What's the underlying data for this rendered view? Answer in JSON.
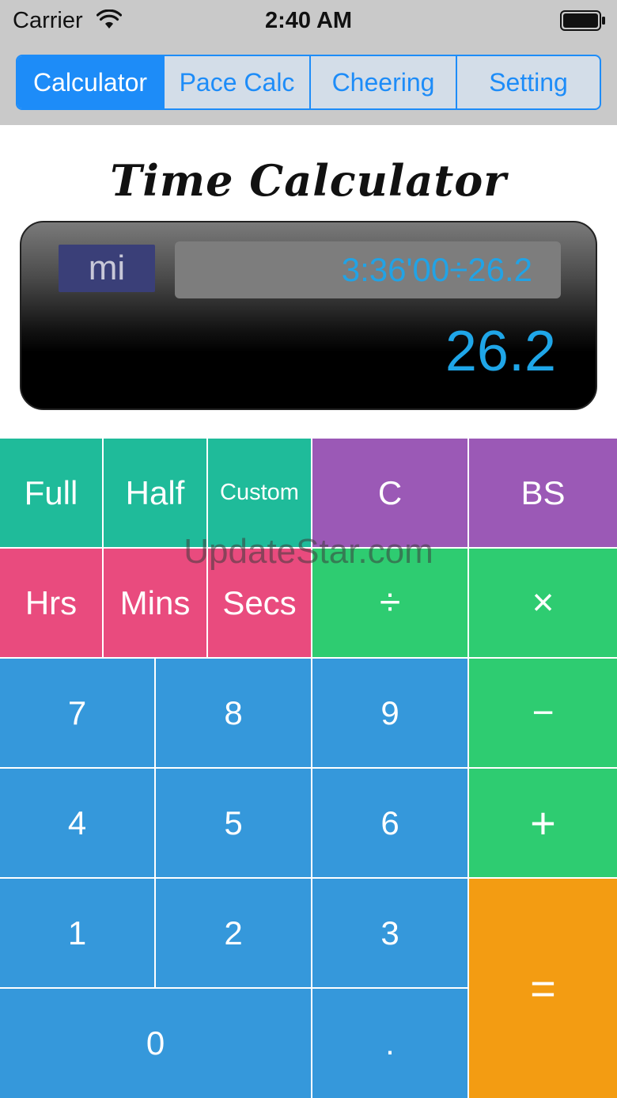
{
  "status_bar": {
    "carrier": "Carrier",
    "time": "2:40 AM",
    "wifi_icon": "wifi-icon",
    "battery_icon": "battery-icon"
  },
  "tabs": [
    {
      "label": "Calculator",
      "active": true
    },
    {
      "label": "Pace Calc",
      "active": false
    },
    {
      "label": "Cheering",
      "active": false
    },
    {
      "label": "Setting",
      "active": false
    }
  ],
  "title": "Time Calculator",
  "display": {
    "unit": "mi",
    "expression": "3:36'00÷26.2",
    "result": "26.2"
  },
  "keypad": {
    "full": "Full",
    "half": "Half",
    "custom": "Custom",
    "clear": "C",
    "backspace": "BS",
    "hrs": "Hrs",
    "mins": "Mins",
    "secs": "Secs",
    "divide": "÷",
    "multiply": "×",
    "seven": "7",
    "eight": "8",
    "nine": "9",
    "minus": "−",
    "four": "4",
    "five": "5",
    "six": "6",
    "plus": "+",
    "one": "1",
    "two": "2",
    "three": "3",
    "equals": "=",
    "zero": "0",
    "decimal": "."
  },
  "watermark": "UpdateStar.com",
  "colors": {
    "accent": "#1d8cf8",
    "teal": "#1fbb9a",
    "purple": "#9b59b6",
    "pink": "#e94b7e",
    "green": "#2ecc71",
    "blue": "#3598db",
    "orange": "#f39c12",
    "display_text": "#1fa6e8"
  }
}
